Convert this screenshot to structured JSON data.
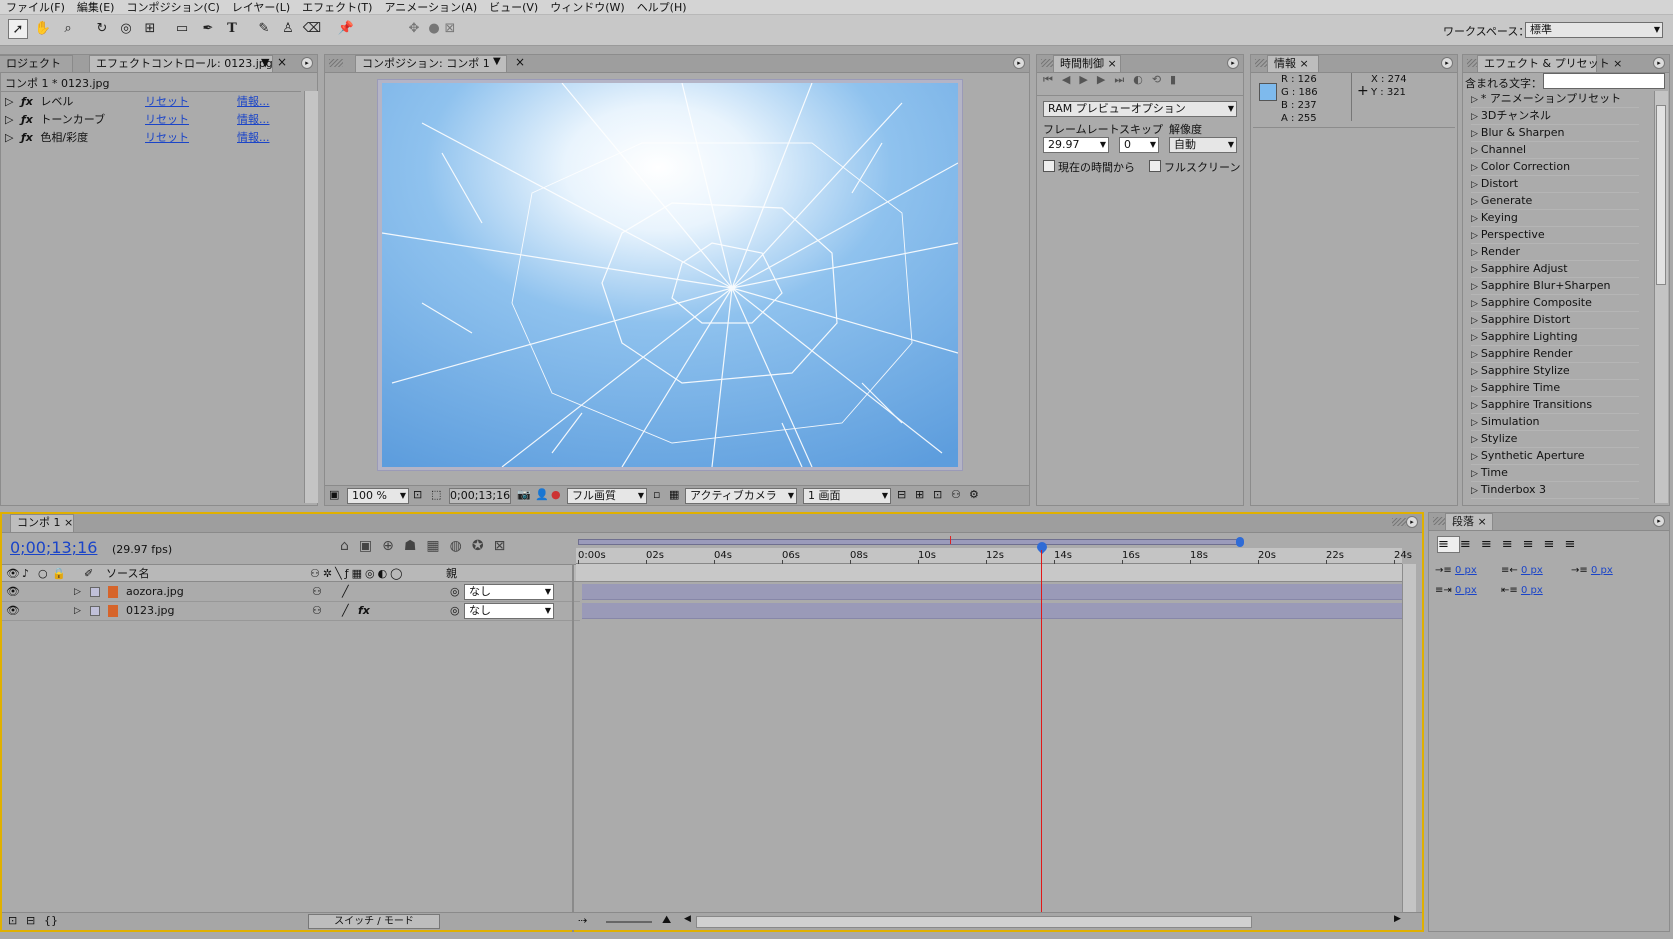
{
  "menu": [
    "ファイル(F)",
    "編集(E)",
    "コンポジション(C)",
    "レイヤー(L)",
    "エフェクト(T)",
    "アニメーション(A)",
    "ビュー(V)",
    "ウィンドウ(W)",
    "ヘルプ(H)"
  ],
  "workspace": {
    "label": "ワークスペース：",
    "value": "標準"
  },
  "left_panel": {
    "tab_project": "ロジェクト",
    "tab_effects": "エフェクトコントロール: 0123.jpg",
    "path": "コンポ 1 * 0123.jpg",
    "effects": [
      {
        "name": "レベル",
        "reset": "リセット",
        "info": "情報..."
      },
      {
        "name": "トーンカーブ",
        "reset": "リセット",
        "info": "情報..."
      },
      {
        "name": "色相/彩度",
        "reset": "リセット",
        "info": "情報..."
      }
    ]
  },
  "comp_panel": {
    "tab": "コンポジション: コンポ 1",
    "zoom": "100 %",
    "timecode": "0;00;13;16",
    "quality": "フル画質",
    "camera": "アクティブカメラ",
    "view": "1 画面"
  },
  "time_panel": {
    "tab": "時間制御",
    "preview_option": "RAM プレビューオプション",
    "framerate_label": "フレームレート",
    "skip_label": "スキップ",
    "resolution_label": "解像度",
    "framerate": "29.97",
    "skip": "0",
    "resolution": "自動",
    "from_current": "現在の時間から",
    "fullscreen": "フルスクリーン"
  },
  "info_panel": {
    "tab": "情報",
    "r": "R : 126",
    "g": "G : 186",
    "b": "B : 237",
    "a": "A : 255",
    "x": "X : 274",
    "y": "Y : 321",
    "swatch": "#7ebaed"
  },
  "fx_panel": {
    "tab": "エフェクト & プリセット",
    "search_label": "含まれる文字：",
    "items": [
      "* アニメーションプリセット",
      "3Dチャンネル",
      "Blur & Sharpen",
      "Channel",
      "Color Correction",
      "Distort",
      "Generate",
      "Keying",
      "Perspective",
      "Render",
      "Sapphire Adjust",
      "Sapphire Blur+Sharpen",
      "Sapphire Composite",
      "Sapphire Distort",
      "Sapphire Lighting",
      "Sapphire Render",
      "Sapphire Stylize",
      "Sapphire Time",
      "Sapphire Transitions",
      "Simulation",
      "Stylize",
      "Synthetic Aperture",
      "Time",
      "Tinderbox 3"
    ]
  },
  "timeline": {
    "tab": "コンポ 1",
    "timecode": "0;00;13;16",
    "fps": "(29.97 fps)",
    "col_source": "ソース名",
    "col_parent": "親",
    "layers": [
      {
        "name": "aozora.jpg",
        "parent": "なし",
        "fx": ""
      },
      {
        "name": "0123.jpg",
        "parent": "なし",
        "fx": "fx"
      }
    ],
    "ruler": [
      "0:00s",
      "02s",
      "04s",
      "06s",
      "08s",
      "10s",
      "12s",
      "14s",
      "16s",
      "18s",
      "20s",
      "22s",
      "24s"
    ],
    "switch_mode": "スイッチ / モード"
  },
  "para_panel": {
    "tab": "段落",
    "v1": "0 px",
    "v2": "0 px",
    "v3": "0 px",
    "v4": "0 px",
    "v5": "0 px"
  }
}
